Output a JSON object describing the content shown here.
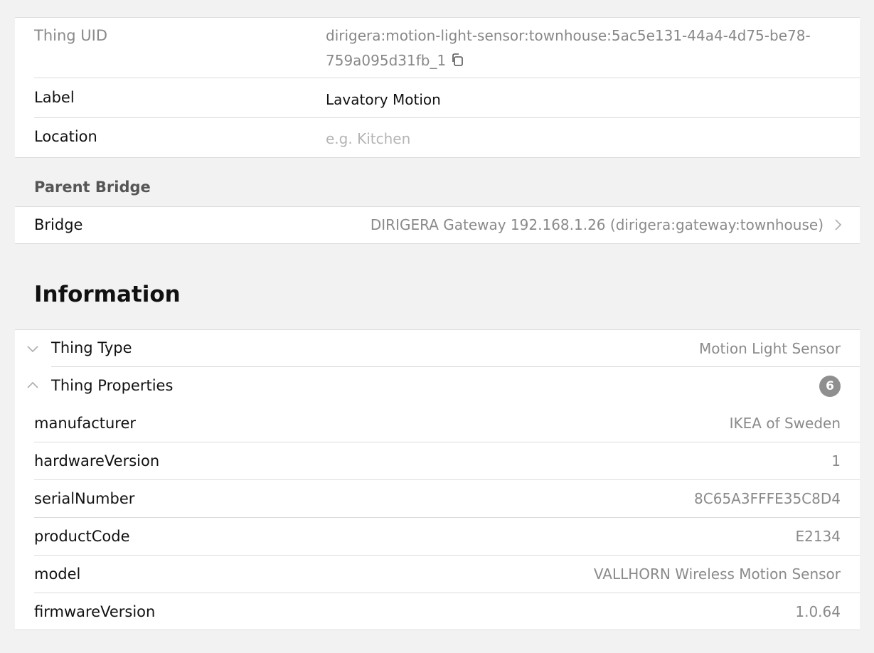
{
  "thing": {
    "uid_label": "Thing UID",
    "uid_line1": "dirigera:motion-light-sensor:townhouse:5ac5e131-44a4-4d75-be78-",
    "uid_line2": "759a095d31fb_1",
    "label_label": "Label",
    "label_value": "Lavatory Motion",
    "location_label": "Location",
    "location_placeholder": "e.g. Kitchen"
  },
  "parent_bridge": {
    "section_title": "Parent Bridge",
    "label": "Bridge",
    "value": "DIRIGERA Gateway 192.168.1.26 (dirigera:gateway:townhouse)"
  },
  "information": {
    "heading": "Information",
    "thing_type_label": "Thing Type",
    "thing_type_value": "Motion Light Sensor",
    "properties_label": "Thing Properties",
    "properties_count": "6",
    "properties": [
      {
        "key": "manufacturer",
        "value": "IKEA of Sweden"
      },
      {
        "key": "hardwareVersion",
        "value": "1"
      },
      {
        "key": "serialNumber",
        "value": "8C65A3FFFE35C8D4"
      },
      {
        "key": "productCode",
        "value": "E2134"
      },
      {
        "key": "model",
        "value": "VALLHORN Wireless Motion Sensor"
      },
      {
        "key": "firmwareVersion",
        "value": "1.0.64"
      }
    ]
  },
  "icons": {
    "copy": "copy-icon",
    "chevron_right": "chevron-right-icon",
    "chevron_down": "chevron-down-icon",
    "chevron_up": "chevron-up-icon"
  },
  "colors": {
    "background": "#f2f2f2",
    "card": "#ffffff",
    "divider": "#dcdcdc",
    "secondary_text": "#8a8a8a",
    "badge": "#8f8f8f"
  }
}
